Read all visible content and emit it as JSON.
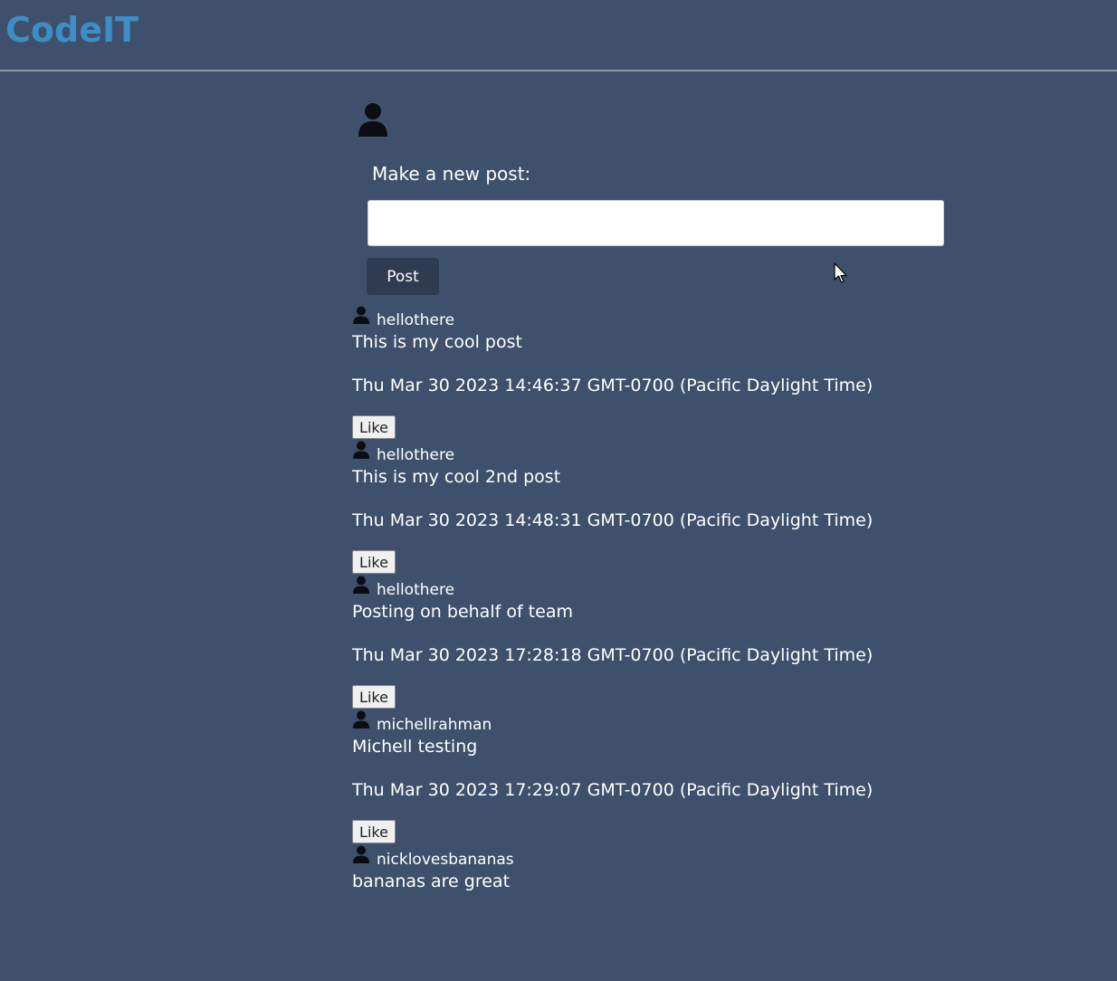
{
  "header": {
    "logo": "CodeIT"
  },
  "composer": {
    "prompt": "Make a new post:",
    "input_value": "",
    "input_placeholder": "",
    "button_label": "Post"
  },
  "posts": [
    {
      "author": "hellothere",
      "content": "This is my cool post",
      "timestamp": "Thu Mar 30 2023 14:46:37 GMT-0700 (Pacific Daylight Time)",
      "like_label": "Like"
    },
    {
      "author": "hellothere",
      "content": "This is my cool 2nd post",
      "timestamp": "Thu Mar 30 2023 14:48:31 GMT-0700 (Pacific Daylight Time)",
      "like_label": "Like"
    },
    {
      "author": "hellothere",
      "content": "Posting on behalf of team",
      "timestamp": "Thu Mar 30 2023 17:28:18 GMT-0700 (Pacific Daylight Time)",
      "like_label": "Like"
    },
    {
      "author": "michellrahman",
      "content": "Michell testing",
      "timestamp": "Thu Mar 30 2023 17:29:07 GMT-0700 (Pacific Daylight Time)",
      "like_label": "Like"
    },
    {
      "author": "nicklovesbananas",
      "content": "bananas are great",
      "timestamp": "",
      "like_label": ""
    }
  ],
  "colors": {
    "background": "#3f506c",
    "logo": "#3c8ec4",
    "post_button": "#2e3b50"
  },
  "icons": {
    "profile": "user-icon",
    "author": "user-icon",
    "cursor": "mouse-pointer-icon"
  }
}
